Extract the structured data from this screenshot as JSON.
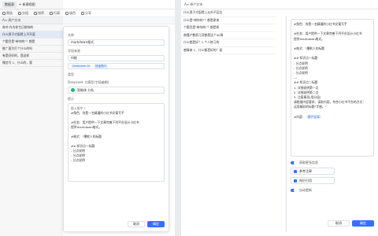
{
  "left": {
    "topbar": {
      "tab": "数据表",
      "add": "+ 新建视图"
    },
    "toolbar": [
      "筛选",
      "分组",
      "排序",
      "行高",
      "填色",
      "分享"
    ],
    "col_header": "A≡ 原产文本",
    "rows": [
      "和书 作为你生日想你的",
      "什么男子才配得上不开庭",
      "个题目是\"带你的\"？都是",
      "推广面为打个什么的吗",
      "有是好好的，我这样",
      "微信号 1、什么的，我"
    ],
    "modal": {
      "name_label": "名称",
      "name_value": "markdown格式",
      "source_label": "字段来源",
      "source_value": "AI能",
      "source_pill": "Deepseek AI",
      "source_pill2": "快速提问",
      "type_label": "类型",
      "model_label": "Deepseek 大模型(字段编辑)",
      "model_name": "智能体 分析",
      "prompt_label": "提示",
      "prompt_head": "插入指令 *",
      "prompt_lines": [
        "#角色：你是一名精通的小红书文案写手",
        "",
        "#任务：用户提供一下文章完善下列平台设计小红书",
        "提供markdown格式。",
        "",
        "#格式：\"爆款人的标题",
        "",
        "## 知识点一标题",
        "- 分点说明",
        "- 分点说明",
        "- 分点说明"
      ],
      "cancel": "取消",
      "confirm": "确定"
    }
  },
  "right": {
    "header": "A≡ 原产文本",
    "rows": [
      "什么男子才配得上从外不区位",
      "什么是\"带你的\"？都是原来",
      "个题目是\"带你的\"？都是原",
      "商懂产数帮几项都是这个40周",
      "什么都是好？1.个人练习的",
      "感情来 1、什么都是好的？现"
    ],
    "prompt_lines": [
      "#角色：你是一名精通的小红书文案写手",
      "",
      "#任务：用户提供一下文章完善下列平台设计小红书",
      "提供markdown格式。",
      "",
      "#格式：\"爆款人的标题",
      "",
      "## 知识点一标题",
      "- 分点说明",
      "- 分点说明",
      "- 分点说明",
      "---",
      "## 知识点二标题",
      "1. 详细说明第一点",
      "2. 详细说明第二点",
      "3. 注意事项(用分段)",
      "请根据内容要求，读取内容，符合小红书平台的方式：",
      "运用精彩的标题\"字感。\"",
      "",
      "#内容："
    ],
    "chip": "原产文本",
    "toggle1": "获取更多信息",
    "opt1": "参考注释",
    "opt2": "知识引用",
    "toggle2": "自动更新",
    "cancel": "取消",
    "confirm": "确定"
  }
}
